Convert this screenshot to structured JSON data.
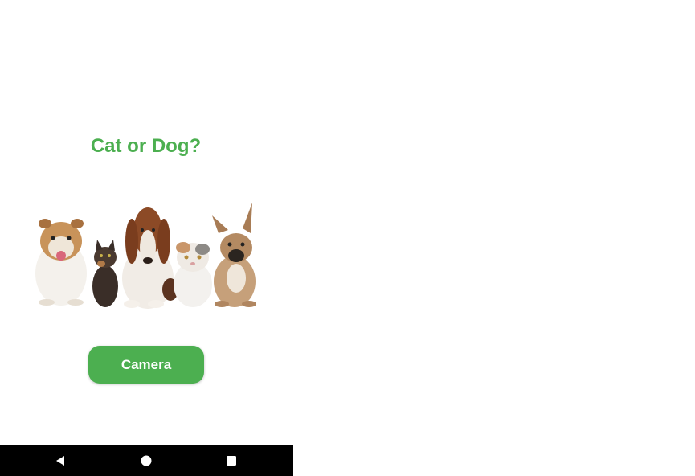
{
  "app": {
    "title": "Cat or Dog?",
    "camera_label": "Camera",
    "pets_image": {
      "description_icon": "pets-photo",
      "animals": [
        "bulldog",
        "kitten",
        "basset-hound",
        "exotic-cat",
        "french-bulldog"
      ]
    }
  },
  "navbar": {
    "back_icon": "back-triangle-icon",
    "home_icon": "home-circle-icon",
    "recents_icon": "recents-square-icon"
  },
  "colors": {
    "accent": "#4caf50",
    "navbar": "#000000",
    "background": "#ffffff"
  }
}
